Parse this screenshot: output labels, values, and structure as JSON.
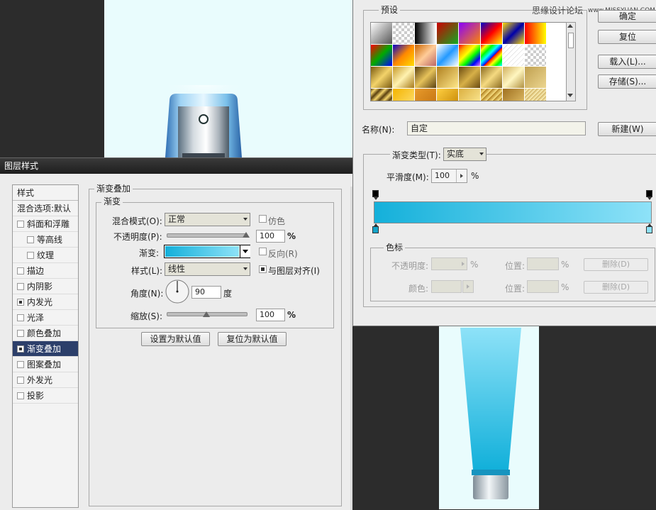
{
  "canvas": {
    "bg_color": "#e9fcfd",
    "watermark": "思缘设计论坛",
    "watermark_url": "www.MISSYUAN.COM"
  },
  "layer_style": {
    "title": "图层样式",
    "sidebar_header": "样式",
    "sidebar_items": [
      {
        "label": "混合选项:默认",
        "checkbox": false,
        "checked": false,
        "selected": false,
        "indent": false
      },
      {
        "label": "斜面和浮雕",
        "checkbox": true,
        "checked": false,
        "selected": false,
        "indent": false
      },
      {
        "label": "等高线",
        "checkbox": true,
        "checked": false,
        "selected": false,
        "indent": true
      },
      {
        "label": "纹理",
        "checkbox": true,
        "checked": false,
        "selected": false,
        "indent": true
      },
      {
        "label": "描边",
        "checkbox": true,
        "checked": false,
        "selected": false,
        "indent": false
      },
      {
        "label": "内阴影",
        "checkbox": true,
        "checked": false,
        "selected": false,
        "indent": false
      },
      {
        "label": "内发光",
        "checkbox": true,
        "checked": true,
        "selected": false,
        "indent": false
      },
      {
        "label": "光泽",
        "checkbox": true,
        "checked": false,
        "selected": false,
        "indent": false
      },
      {
        "label": "颜色叠加",
        "checkbox": true,
        "checked": false,
        "selected": false,
        "indent": false
      },
      {
        "label": "渐变叠加",
        "checkbox": true,
        "checked": true,
        "selected": true,
        "indent": false
      },
      {
        "label": "图案叠加",
        "checkbox": true,
        "checked": false,
        "selected": false,
        "indent": false
      },
      {
        "label": "外发光",
        "checkbox": true,
        "checked": false,
        "selected": false,
        "indent": false
      },
      {
        "label": "投影",
        "checkbox": true,
        "checked": false,
        "selected": false,
        "indent": false
      }
    ],
    "panel_title": "渐变叠加",
    "group_title": "渐变",
    "blend_mode_label": "混合模式(O):",
    "blend_mode_value": "正常",
    "dither_label": "仿色",
    "opacity_label": "不透明度(P):",
    "opacity_value": "100",
    "opacity_unit": "%",
    "opacity_fraction": 1.0,
    "gradient_label": "渐变:",
    "reverse_label": "反向(R)",
    "style_label": "样式(L):",
    "style_value": "线性",
    "align_label": "与图层对齐(I)",
    "align_checked": true,
    "angle_label": "角度(N):",
    "angle_value": "90",
    "angle_unit": "度",
    "scale_label": "缩放(S):",
    "scale_value": "100",
    "scale_unit": "%",
    "scale_fraction": 0.5,
    "set_default_btn": "设置为默认值",
    "reset_default_btn": "复位为默认值"
  },
  "gradient_editor": {
    "presets_label": "预设",
    "ok_btn": "确定",
    "reset_btn": "复位",
    "load_btn": "载入(L)...",
    "save_btn": "存储(S)...",
    "name_label": "名称(N):",
    "name_value": "自定",
    "new_btn": "新建(W)",
    "type_label": "渐变类型(T):",
    "type_value": "实底",
    "smooth_label": "平滑度(M):",
    "smooth_value": "100",
    "smooth_unit": "%",
    "stops_group": "色标",
    "stop_opacity_label": "不透明度:",
    "stop_opacity_unit": "%",
    "stop_position_label": "位置:",
    "stop_position_unit": "%",
    "delete_btn": "删除(D)",
    "stop_color_label": "颜色:",
    "stop_position2_label": "位置:",
    "stop_position2_unit": "%",
    "delete_btn2": "删除(D)",
    "gradient_start_color": "#14b0da",
    "gradient_end_color": "#8ee2f8"
  }
}
